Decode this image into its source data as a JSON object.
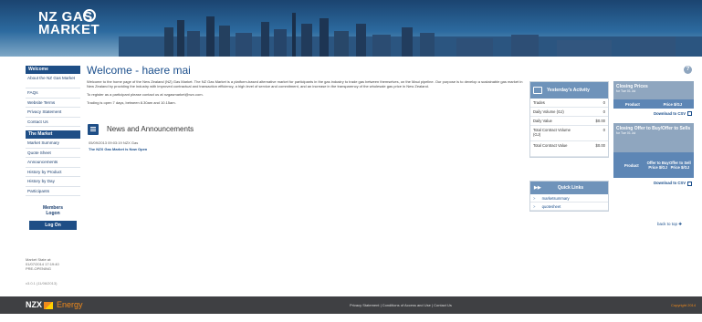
{
  "header": {
    "logo_line1": "NZ GAS",
    "logo_line2": "MARKET"
  },
  "sidebar": {
    "welcome_heading": "Welcome",
    "welcome_items": [
      "About the NZ Gas Market",
      "FAQs",
      "Website Terms",
      "Privacy Statement",
      "Contact Us"
    ],
    "market_heading": "The Market",
    "market_items": [
      "Market Summary",
      "Quote Sheet",
      "Announcements",
      "History by Product",
      "History by Day",
      "Participants"
    ],
    "members_line1": "Members",
    "members_line2": "Logon",
    "logon_button": "Log On",
    "market_state_label": "Market State at:",
    "market_state_time": "01/07/2014 17:19:40",
    "market_state_value": "PRE-OPENING",
    "version": "v3.0.1 (11/06/2013)"
  },
  "main": {
    "title": "Welcome - haere mai",
    "intro_paragraph": "Welcome to the home page of the New Zealand (NZ) Gas Market. The NZ Gas Market is a platform-based alternative market for participants in the gas industry to trade gas between themselves, on the Maui pipeline. Our purpose is to develop a sustainable gas market in New Zealand by providing the industry with improved contractual and transaction efficiency, a high level of service and commitment, and an increase in the transparency of the wholesale gas price in New Zealand.",
    "register_text": "To register as a participant please contact us at nzgasmarket@nzx.com.",
    "trading_hours": "Trading is open 7 days, between 8.30am and 10.15am.",
    "news_title": "News and Announcements",
    "news_meta": "05/09/2013 09:03:19   NZX Gas",
    "news_link": "The NZX Gas Market is Now Open"
  },
  "activity": {
    "title": "Yesterday's Activity",
    "rows": [
      {
        "label": "Trades",
        "value": "0"
      },
      {
        "label": "Daily Volume (GJ)",
        "value": "0"
      },
      {
        "label": "Daily Value",
        "value": "$0.00"
      },
      {
        "label": "Total Contract Volume (GJ)",
        "value": "0"
      },
      {
        "label": "Total Contract Value",
        "value": "$0.00"
      }
    ]
  },
  "quick_links": {
    "title": "Quick Links",
    "items": [
      "marketsummary",
      "quotesheet"
    ]
  },
  "closing_prices": {
    "title": "Closing Prices",
    "subtitle": "for Tue 01 Jul",
    "col_product": "Product",
    "col_price": "Price $/GJ",
    "download": "Download to CSV"
  },
  "closing_offers": {
    "title": "Closing Offer to Buy/Offer to Sells",
    "subtitle": "for Tue 01 Jul",
    "col_product": "Product",
    "col_buy": "Offer to Buy Price $/GJ",
    "col_sell": "Offer to Sell Price $/GJ",
    "download": "Download to CSV"
  },
  "back_to_top": "back to top",
  "footer": {
    "logo_nzx": "NZX",
    "logo_energy": "Energy",
    "links": "Privacy Statement | Conditions of Access and Use | Contact Us",
    "copyright": "Copyright 2014"
  }
}
